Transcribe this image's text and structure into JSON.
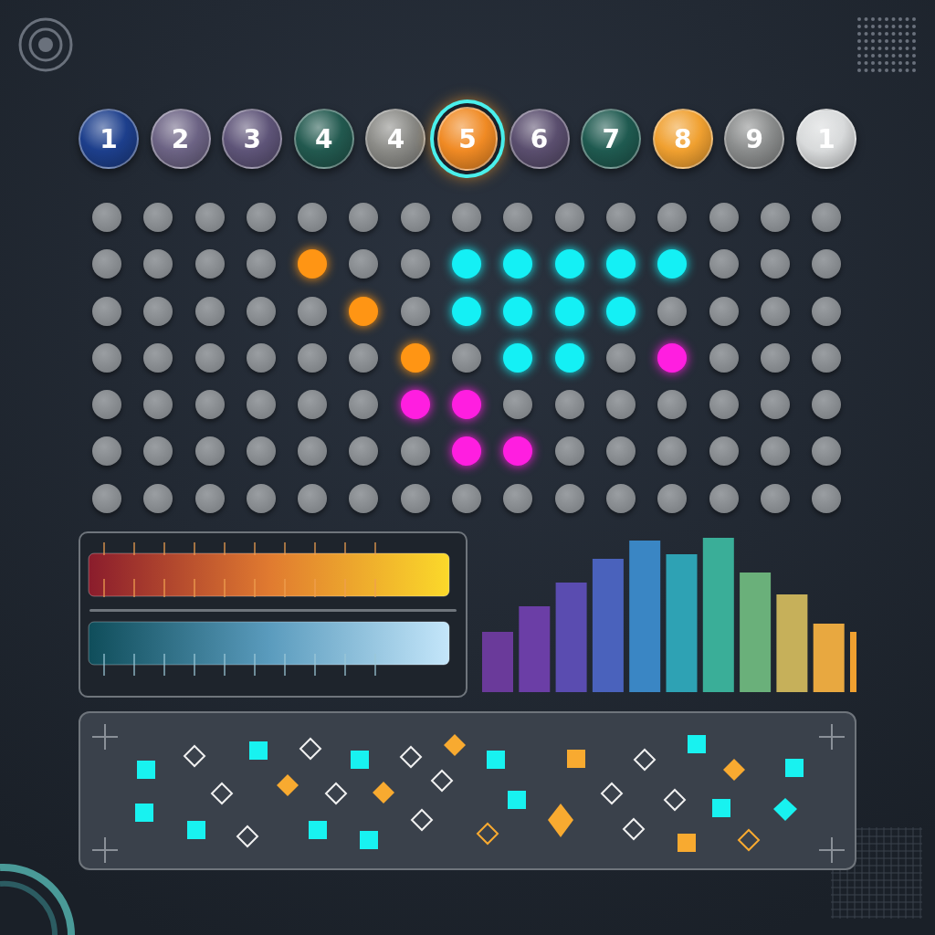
{
  "balls": [
    {
      "label": "1",
      "color": "#1d3f8c",
      "selected": false
    },
    {
      "label": "2",
      "color": "#6c6384",
      "selected": false
    },
    {
      "label": "3",
      "color": "#5e5478",
      "selected": false
    },
    {
      "label": "4",
      "color": "#22594f",
      "selected": false
    },
    {
      "label": "4",
      "color": "#8a8a86",
      "selected": false
    },
    {
      "label": "5",
      "color": "#f08a24",
      "selected": true
    },
    {
      "label": "6",
      "color": "#5a4e6e",
      "selected": false
    },
    {
      "label": "7",
      "color": "#1f5a50",
      "selected": false
    },
    {
      "label": "8",
      "color": "#f0a030",
      "selected": false
    },
    {
      "label": "9",
      "color": "#8a8c8c",
      "selected": false
    },
    {
      "label": "1",
      "color": "#d8dadb",
      "selected": false
    }
  ],
  "grid": [
    {
      "cells": [
        {
          "lit": false
        },
        {
          "lit": false
        },
        {
          "lit": false
        },
        {
          "lit": false
        },
        {
          "lit": false
        },
        {
          "lit": false
        },
        {
          "lit": false
        },
        {
          "lit": false
        },
        {
          "lit": false
        },
        {
          "lit": false
        },
        {
          "lit": false
        },
        {
          "lit": false
        },
        {
          "lit": false
        },
        {
          "lit": false
        },
        {
          "lit": false
        }
      ]
    },
    {
      "cells": [
        {
          "lit": false
        },
        {
          "lit": false
        },
        {
          "lit": false
        },
        {
          "lit": false
        },
        {
          "lit": true,
          "color": "#ff9514"
        },
        {
          "lit": false
        },
        {
          "lit": false
        },
        {
          "lit": true,
          "color": "#14f0f5"
        },
        {
          "lit": true,
          "color": "#14f0f5"
        },
        {
          "lit": true,
          "color": "#14f0f5"
        },
        {
          "lit": true,
          "color": "#14f0f5"
        },
        {
          "lit": true,
          "color": "#14f0f5"
        },
        {
          "lit": false
        },
        {
          "lit": false
        },
        {
          "lit": false
        }
      ]
    },
    {
      "cells": [
        {
          "lit": false
        },
        {
          "lit": false
        },
        {
          "lit": false
        },
        {
          "lit": false
        },
        {
          "lit": false
        },
        {
          "lit": true,
          "color": "#ff9514"
        },
        {
          "lit": false
        },
        {
          "lit": true,
          "color": "#14f0f5"
        },
        {
          "lit": true,
          "color": "#14f0f5"
        },
        {
          "lit": true,
          "color": "#14f0f5"
        },
        {
          "lit": true,
          "color": "#14f0f5"
        },
        {
          "lit": false
        },
        {
          "lit": false
        },
        {
          "lit": false
        },
        {
          "lit": false
        }
      ]
    },
    {
      "cells": [
        {
          "lit": false
        },
        {
          "lit": false
        },
        {
          "lit": false
        },
        {
          "lit": false
        },
        {
          "lit": false
        },
        {
          "lit": false
        },
        {
          "lit": true,
          "color": "#ff9514"
        },
        {
          "lit": false
        },
        {
          "lit": true,
          "color": "#14f0f5"
        },
        {
          "lit": true,
          "color": "#14f0f5"
        },
        {
          "lit": false
        },
        {
          "lit": true,
          "color": "#ff1ee0"
        },
        {
          "lit": false
        },
        {
          "lit": false
        },
        {
          "lit": false
        }
      ]
    },
    {
      "cells": [
        {
          "lit": false
        },
        {
          "lit": false
        },
        {
          "lit": false
        },
        {
          "lit": false
        },
        {
          "lit": false
        },
        {
          "lit": false
        },
        {
          "lit": true,
          "color": "#ff1ee0"
        },
        {
          "lit": true,
          "color": "#ff1ee0"
        },
        {
          "lit": false
        },
        {
          "lit": false
        },
        {
          "lit": false
        },
        {
          "lit": false
        },
        {
          "lit": false
        },
        {
          "lit": false
        },
        {
          "lit": false
        }
      ]
    },
    {
      "cells": [
        {
          "lit": false
        },
        {
          "lit": false
        },
        {
          "lit": false
        },
        {
          "lit": false
        },
        {
          "lit": false
        },
        {
          "lit": false
        },
        {
          "lit": false
        },
        {
          "lit": true,
          "color": "#ff1ee0"
        },
        {
          "lit": true,
          "color": "#ff1ee0"
        },
        {
          "lit": false
        },
        {
          "lit": false
        },
        {
          "lit": false
        },
        {
          "lit": false
        },
        {
          "lit": false
        },
        {
          "lit": false
        }
      ]
    },
    {
      "cells": [
        {
          "lit": false
        },
        {
          "lit": false
        },
        {
          "lit": false
        },
        {
          "lit": false
        },
        {
          "lit": false
        },
        {
          "lit": false
        },
        {
          "lit": false
        },
        {
          "lit": false
        },
        {
          "lit": false
        },
        {
          "lit": false
        },
        {
          "lit": false
        },
        {
          "lit": false
        },
        {
          "lit": false
        },
        {
          "lit": false
        },
        {
          "lit": false
        }
      ]
    }
  ],
  "meters": [
    {
      "kind": "warm"
    },
    {
      "kind": "cool"
    }
  ]
}
